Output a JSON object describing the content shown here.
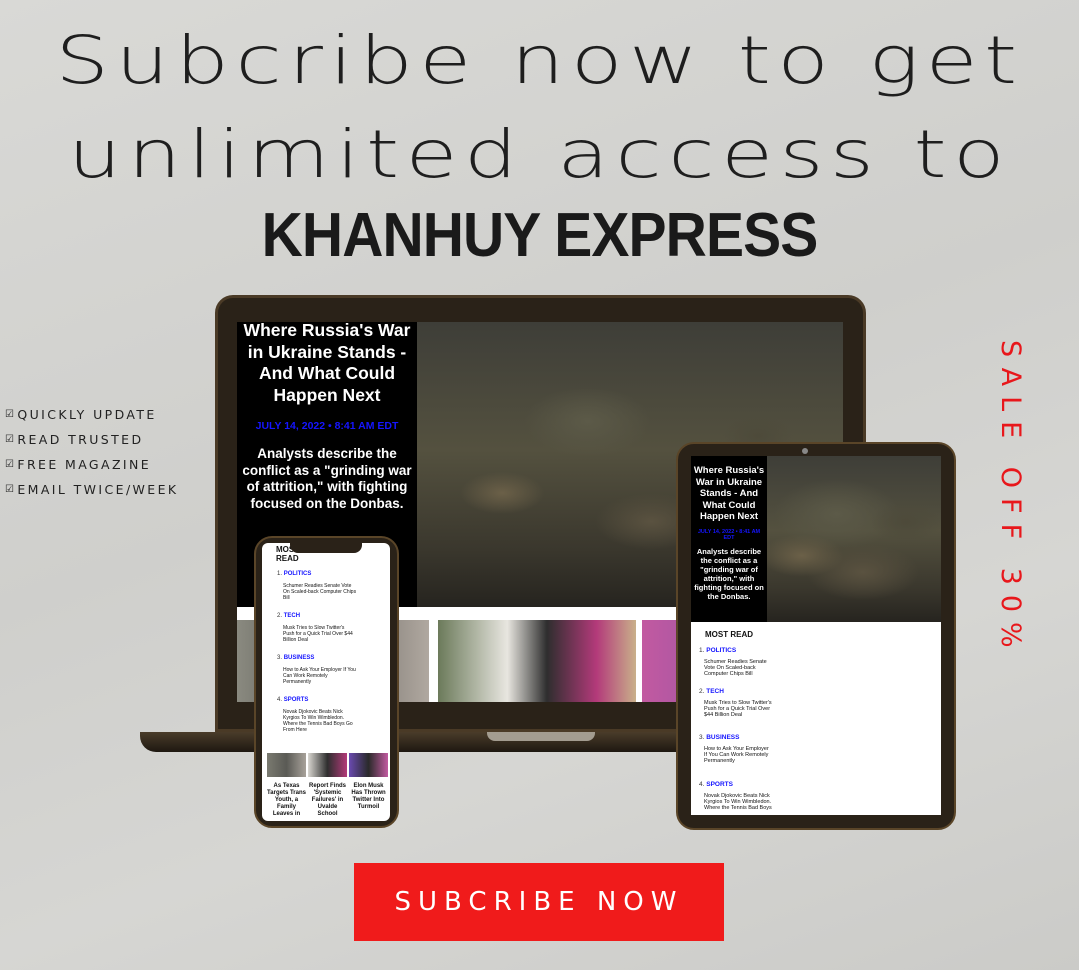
{
  "headline": {
    "line1": "Subcribe now to get",
    "line2": "unlimited access to",
    "brand": "KHANHUY EXPRESS"
  },
  "features": [
    "QUICKLY UPDATE",
    "READ TRUSTED",
    "FREE MAGAZINE",
    "EMAIL TWICE/WEEK"
  ],
  "feature_check": "☑",
  "sale_badge": "SALE OFF 30%",
  "cta_label": "SUBCRIBE NOW",
  "article": {
    "title": "Where Russia's War in Ukraine Stands - And What Could Happen Next",
    "date": "JULY 14, 2022 • 8:41 AM EDT",
    "summary": "Analysts describe the conflict as a \"grinding war of attrition,\" with fighting focused on the Donbas."
  },
  "most_read": {
    "title": "MOST READ",
    "items": [
      {
        "num": "1.",
        "category": "POLITICS",
        "headline": "Schumer Readies Senate Vote On Scaled-back Computer Chips Bill"
      },
      {
        "num": "2.",
        "category": "TECH",
        "headline": "Musk Tries to Slow Twitter's Push for a Quick Trial Over $44 Billion Deal"
      },
      {
        "num": "3.",
        "category": "BUSINESS",
        "headline": "How to Ask Your Employer If You Can Work Remotely Permanently"
      },
      {
        "num": "4.",
        "category": "SPORTS",
        "headline": "Novak Djokovic Beats Nick Kyrgios To Win Wimbledon. Where the Tennis Bad Boys Go From Here"
      }
    ]
  },
  "phone_cards": [
    "As Texas Targets Trans Youth, a Family Leaves in",
    "Report Finds 'Systemic Failures' in Uvalde School",
    "Elon Musk Has Thrown Twitter Into Turmoil"
  ],
  "colors": {
    "accent": "#f01b1b",
    "link_blue": "#1515ff",
    "device_frame": "#2a2218"
  }
}
